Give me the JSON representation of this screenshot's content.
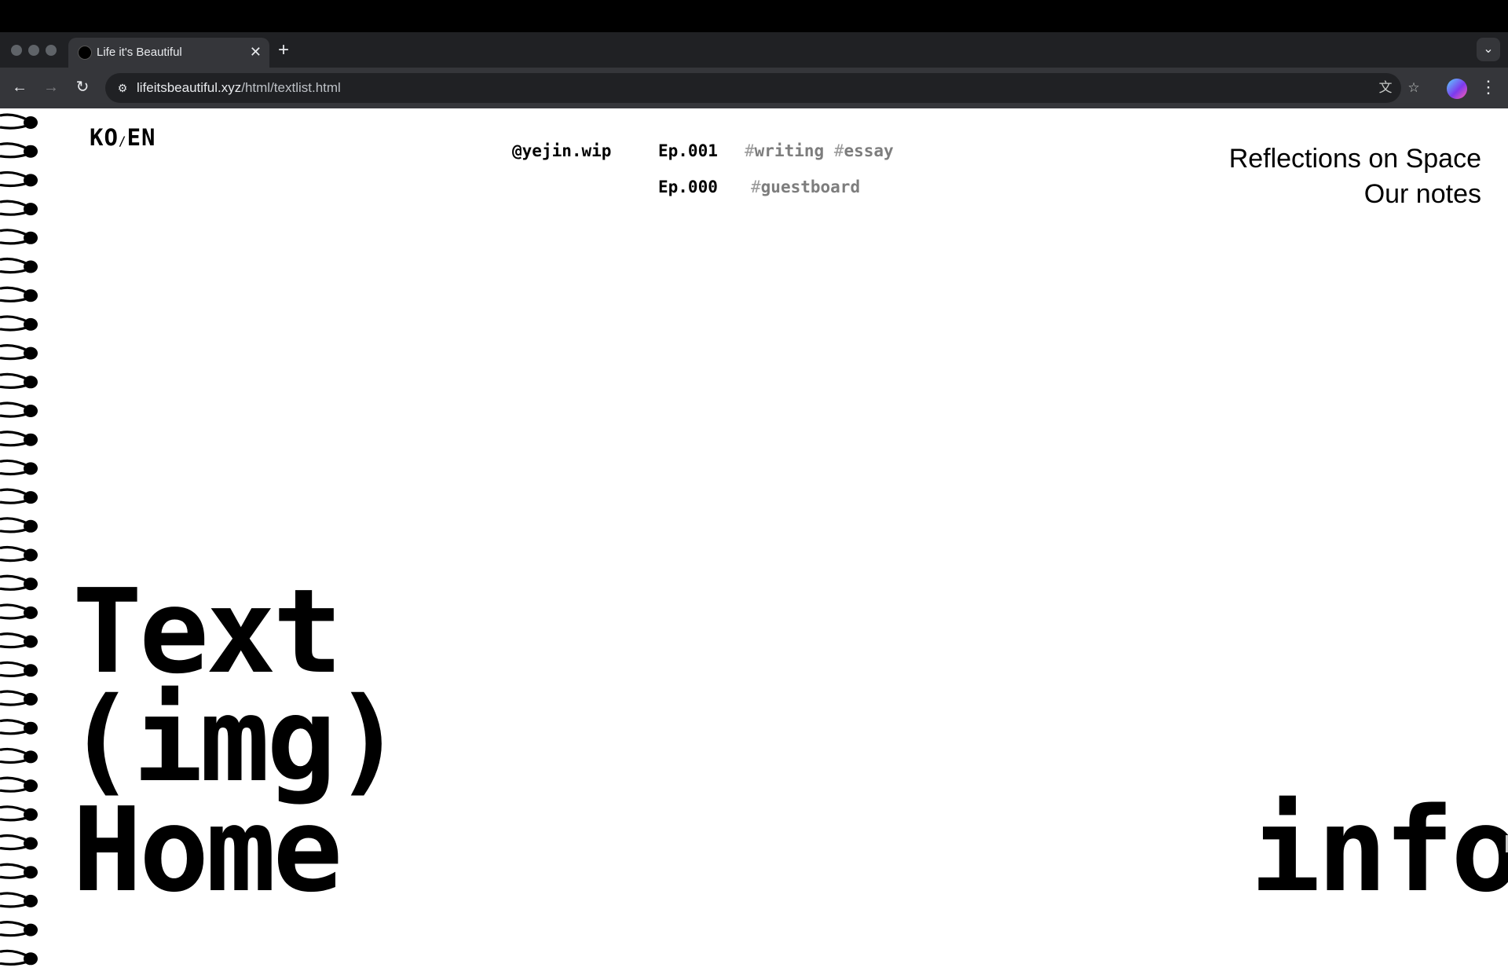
{
  "browser": {
    "tab_title": "Life it's Beautiful",
    "tab_close_icon": "close-icon",
    "new_tab_icon": "plus-icon",
    "tab_menu_icon": "chevron-down-icon",
    "url_host": "lifeitsbeautiful.xyz",
    "url_path": "/html/textlist.html",
    "icons": {
      "back": "back-arrow-icon",
      "forward": "forward-arrow-icon",
      "reload": "reload-icon",
      "site_info": "tune-icon",
      "translate": "translate-icon",
      "bookmark": "star-icon",
      "profile": "profile-avatar",
      "menu": "kebab-menu-icon"
    }
  },
  "page": {
    "lang": {
      "ko": "KO",
      "sep": "/",
      "en": "EN"
    },
    "handle": "@yejin.wip",
    "episodes": [
      {
        "number": "Ep.001",
        "tags": [
          "writing",
          "essay"
        ]
      },
      {
        "number": "Ep.000",
        "tags": [
          "guestboard"
        ]
      }
    ],
    "right_links": [
      "Reflections on Space",
      "Our notes"
    ],
    "big_nav": {
      "text": "Text",
      "img": "(img)",
      "home": "Home",
      "info": "info"
    }
  },
  "colors": {
    "chrome_dark": "#202124",
    "chrome_mid": "#35363a",
    "page_bg": "#ffffff",
    "ink": "#000000",
    "tag_gray": "#7d7d7d"
  }
}
